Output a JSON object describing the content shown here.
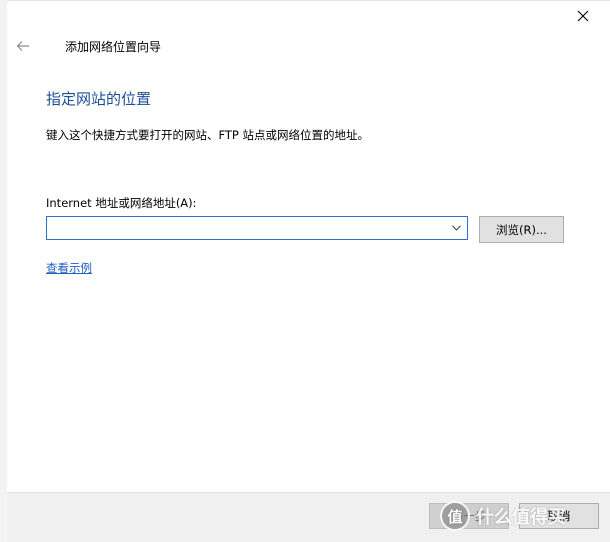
{
  "window": {
    "title": "添加网络位置向导"
  },
  "content": {
    "heading": "指定网站的位置",
    "description": "键入这个快捷方式要打开的网站、FTP 站点或网络位置的地址。",
    "address_label": "Internet 地址或网络地址(A):",
    "address_value": "",
    "browse_label": "浏览(R)...",
    "example_link": "查看示例"
  },
  "footer": {
    "next_label": "下一步",
    "cancel_label": "取消"
  },
  "watermark": {
    "logo_char": "值",
    "text": "什么值得买"
  },
  "icons": {
    "back": "arrow-left-icon",
    "close": "close-icon",
    "dropdown": "chevron-down-icon"
  },
  "colors": {
    "heading": "#1f4e97",
    "link": "#1f5fbf",
    "input_border_focus": "#2f6fcf",
    "footer_bg": "#f0f0f0",
    "button_bg": "#e1e1e1"
  }
}
